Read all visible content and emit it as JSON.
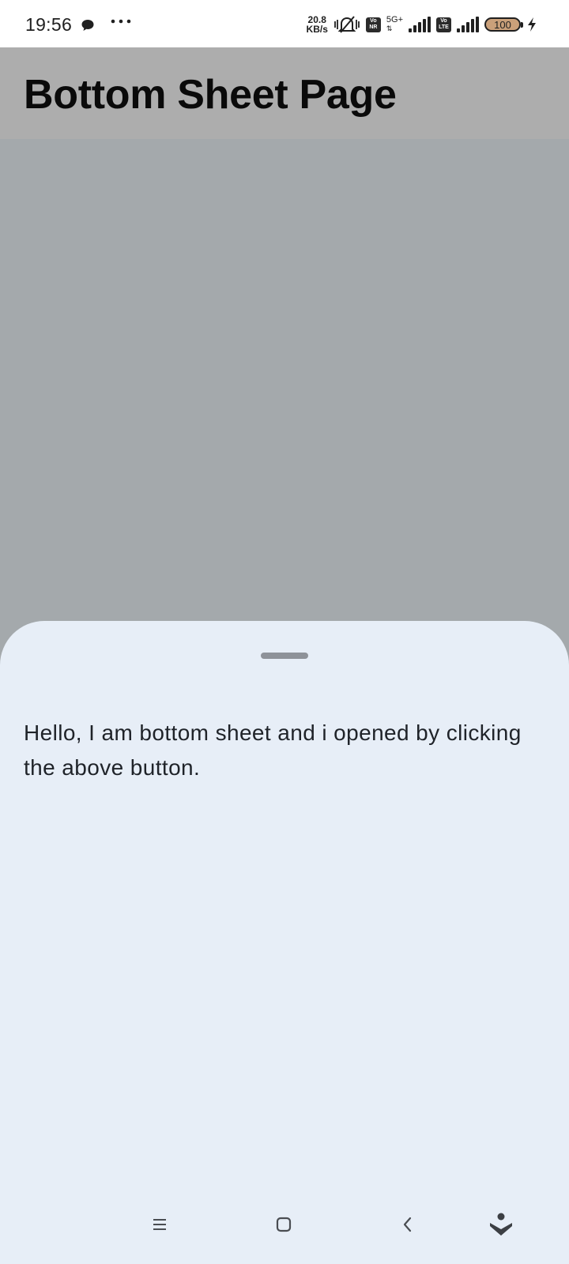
{
  "status_bar": {
    "time": "19:56",
    "net_speed_value": "20.8",
    "net_speed_unit": "KB/s",
    "sim1_tag_top": "Vo",
    "sim1_tag_bottom": "NR",
    "sim1_generation": "5G+",
    "sim2_tag_top": "Vo",
    "sim2_tag_bottom": "LTE",
    "battery_level": "100",
    "icons": [
      "chat-bubble-icon",
      "more-dots-icon",
      "mute-vibrate-icon",
      "signal-icon",
      "battery-icon",
      "charging-bolt-icon"
    ]
  },
  "app_bar": {
    "title": "Bottom Sheet Page",
    "background_color": "#adadad"
  },
  "bottom_sheet": {
    "text": "Hello, I am bottom sheet and i opened by clicking the above button.",
    "background_color": "#e7eef7"
  },
  "nav_bar": {
    "icons": [
      "recents-icon",
      "home-icon",
      "back-icon",
      "assistant-icon"
    ]
  }
}
